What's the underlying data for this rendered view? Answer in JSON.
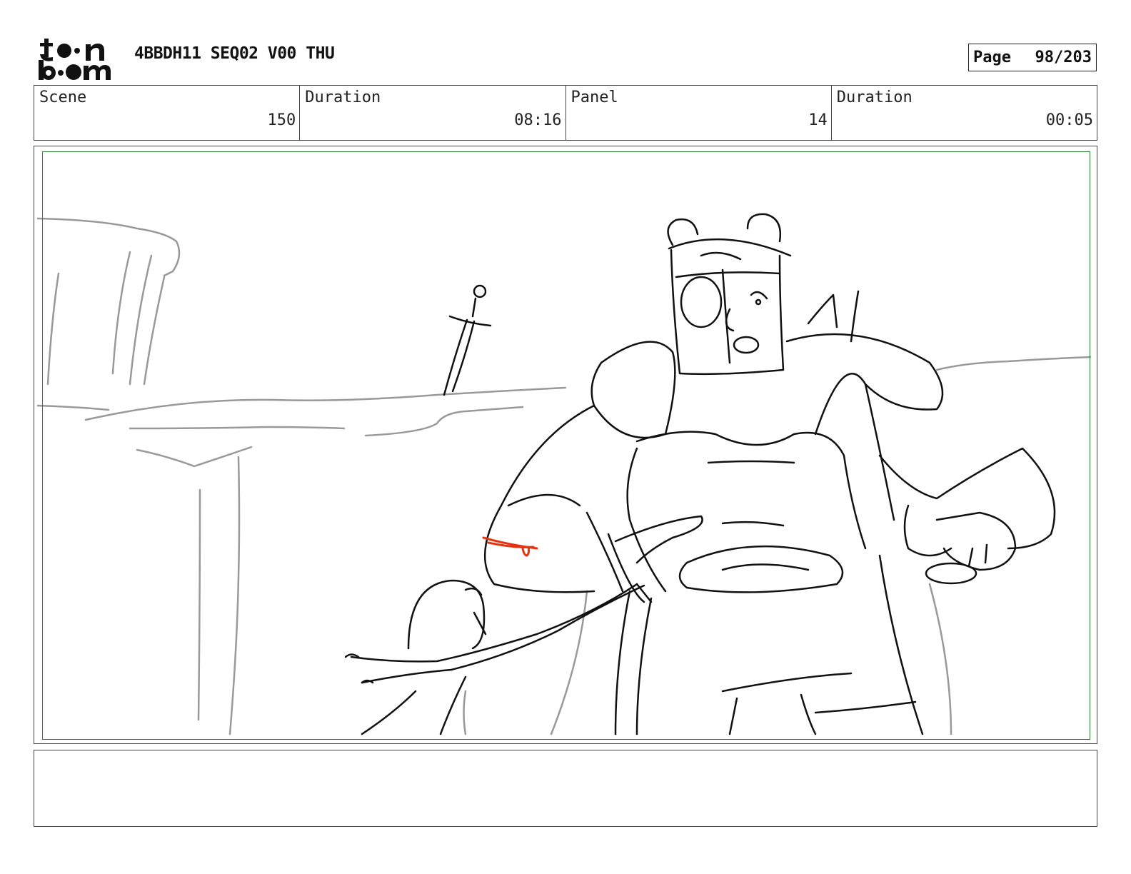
{
  "header": {
    "logo_text": "toon boom",
    "title": "4BBDH11 SEQ02 V00 THU",
    "page_label": "Page",
    "page_value": "98/203"
  },
  "info": {
    "scene_label": "Scene",
    "scene_value": "150",
    "scene_duration_label": "Duration",
    "scene_duration_value": "08:16",
    "panel_label": "Panel",
    "panel_value": "14",
    "panel_duration_label": "Duration",
    "panel_duration_value": "00:05"
  },
  "notes": {
    "text": ""
  }
}
